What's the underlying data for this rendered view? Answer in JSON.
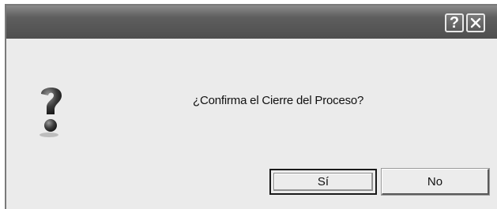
{
  "window": {
    "help_icon": "question-mark-icon",
    "close_icon": "close-icon",
    "help_glyph": "?"
  },
  "dialog": {
    "icon": "question-icon",
    "message": "¿Confirma el Cierre del Proceso?",
    "yes_label": "Sí",
    "no_label": "No"
  },
  "colors": {
    "titlebar": "#5a5a5a",
    "body": "#ebebeb"
  }
}
